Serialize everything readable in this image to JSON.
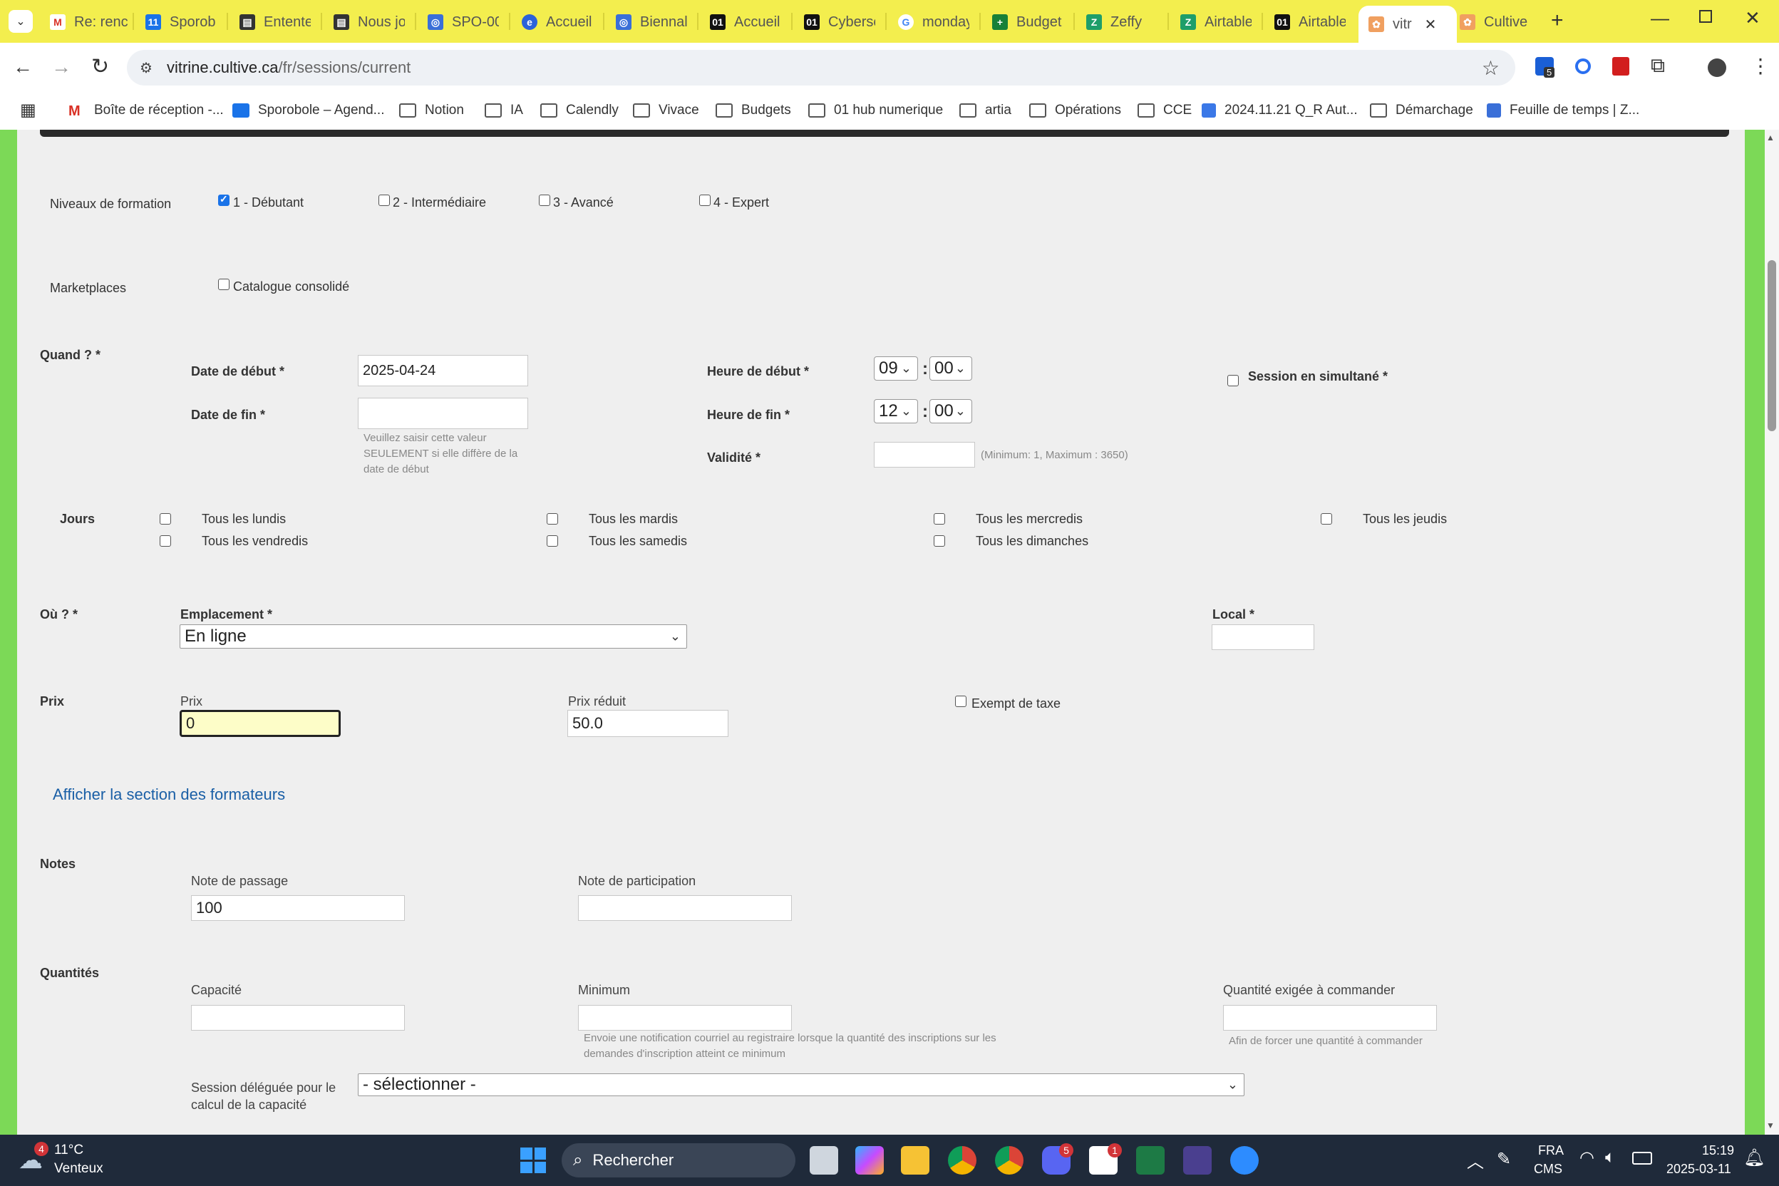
{
  "browser": {
    "tabs": [
      {
        "label": "Re: renc",
        "icon": "gmail-icon"
      },
      {
        "label": "Sporob",
        "icon": "calendar-icon"
      },
      {
        "label": "Entente",
        "icon": "doc-icon"
      },
      {
        "label": "Nous jo",
        "icon": "doc-icon"
      },
      {
        "label": "SPO-00",
        "icon": "form-icon"
      },
      {
        "label": "Accueil",
        "icon": "edge-icon"
      },
      {
        "label": "Biennal",
        "icon": "form-icon"
      },
      {
        "label": "Accueil",
        "icon": "o1-icon"
      },
      {
        "label": "Cyberse",
        "icon": "o1-icon"
      },
      {
        "label": "monday",
        "icon": "google-icon"
      },
      {
        "label": "Budget",
        "icon": "sheets-icon"
      },
      {
        "label": "Zeffy",
        "icon": "zeffy-icon"
      },
      {
        "label": "Airtable",
        "icon": "zeffy-icon"
      },
      {
        "label": "Airtable",
        "icon": "o1-icon"
      },
      {
        "label": "vitr",
        "icon": "cultive-icon",
        "active": true
      },
      {
        "label": "Cultive",
        "icon": "cultive-icon"
      }
    ],
    "url_host": "vitrine.cultive.ca",
    "url_path": "/fr/sessions/current",
    "extension_badge": "5",
    "bookmarks": [
      {
        "label": "Boîte de réception -...",
        "icon": "gmail-icon"
      },
      {
        "label": "Sporobole – Agend...",
        "icon": "calendar-icon"
      },
      {
        "label": "Notion",
        "icon": "folder-icon"
      },
      {
        "label": "IA",
        "icon": "folder-icon"
      },
      {
        "label": "Calendly",
        "icon": "folder-icon"
      },
      {
        "label": "Vivace",
        "icon": "folder-icon"
      },
      {
        "label": "Budgets",
        "icon": "folder-icon"
      },
      {
        "label": "01 hub numerique",
        "icon": "folder-icon"
      },
      {
        "label": "artia",
        "icon": "folder-icon"
      },
      {
        "label": "Opérations",
        "icon": "folder-icon"
      },
      {
        "label": "CCE",
        "icon": "folder-icon"
      },
      {
        "label": "2024.11.21 Q_R Aut...",
        "icon": "docs-icon"
      },
      {
        "label": "Démarchage",
        "icon": "folder-icon"
      },
      {
        "label": "Feuille de temps | Z...",
        "icon": "form-icon"
      }
    ]
  },
  "form": {
    "levels": {
      "label": "Niveaux de formation",
      "options": [
        {
          "label": "1 - Débutant",
          "checked": true
        },
        {
          "label": "2 - Intermédiaire",
          "checked": false
        },
        {
          "label": "3 - Avancé",
          "checked": false
        },
        {
          "label": "4 - Expert",
          "checked": false
        }
      ]
    },
    "marketplaces": {
      "label": "Marketplaces",
      "option": "Catalogue consolidé"
    },
    "when": {
      "label": "Quand ? *",
      "start_date_label": "Date de début *",
      "start_date": "2025-04-24",
      "end_date_label": "Date de fin *",
      "end_date": "",
      "end_date_help": [
        "Veuillez saisir cette valeur",
        "SEULEMENT si elle diffère de la",
        "date de début"
      ],
      "start_time_label": "Heure de début *",
      "start_hour": "09",
      "start_min": "00",
      "end_time_label": "Heure de fin *",
      "end_hour": "12",
      "end_min": "00",
      "time_sep": ":",
      "validity_label": "Validité *",
      "validity": "",
      "validity_help": "(Minimum: 1, Maximum : 3650)",
      "simultaneous_label": "Session en simultané *"
    },
    "days": {
      "label": "Jours",
      "items": [
        "Tous les lundis",
        "Tous les mardis",
        "Tous les mercredis",
        "Tous les jeudis",
        "Tous les vendredis",
        "Tous les samedis",
        "Tous les dimanches"
      ]
    },
    "where": {
      "label": "Où ? *",
      "location_label": "Emplacement *",
      "location": "En ligne",
      "room_label": "Local *",
      "room": ""
    },
    "price": {
      "label": "Prix",
      "price_label": "Prix",
      "price": "0",
      "reduced_label": "Prix réduit",
      "reduced": "50.0",
      "tax_exempt_label": "Exempt de taxe"
    },
    "trainers_link": "Afficher la section des formateurs",
    "notes": {
      "label": "Notes",
      "pass_label": "Note de passage",
      "pass": "100",
      "participation_label": "Note de participation",
      "participation": ""
    },
    "quantities": {
      "label": "Quantités",
      "capacity_label": "Capacité",
      "minimum_label": "Minimum",
      "minimum_help": [
        "Envoie une notification courriel au registraire lorsque la quantité des inscriptions sur les",
        "demandes d'inscription atteint ce minimum"
      ],
      "required_label": "Quantité exigée à commander",
      "required_help": "Afin de forcer une quantité à commander",
      "delegated_label": [
        "Session déléguée pour le",
        "calcul de la capacité"
      ],
      "delegated": "- sélectionner -"
    }
  },
  "taskbar": {
    "weather_temp": "11°C",
    "weather_desc": "Venteux",
    "weather_badge": "4",
    "search_placeholder": "Rechercher",
    "lang": "FRA",
    "lang2": "CMS",
    "time": "15:19",
    "date": "2025-03-11",
    "discord_badge": "5",
    "notion_badge": "1"
  }
}
